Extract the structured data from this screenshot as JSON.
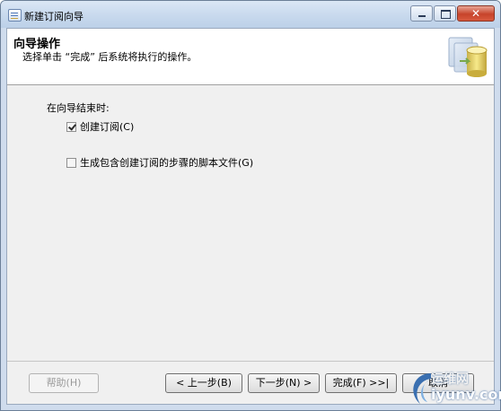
{
  "window": {
    "title": "新建订阅向导"
  },
  "header": {
    "title": "向导操作",
    "subtitle": "选择单击 “完成” 后系统将执行的操作。"
  },
  "content": {
    "label": "在向导结束时:",
    "options": [
      {
        "label": "创建订阅(C)",
        "checked": true
      },
      {
        "label": "生成包含创建订阅的步骤的脚本文件(G)",
        "checked": false
      }
    ]
  },
  "buttons": {
    "help": "帮助(H)",
    "back": "< 上一步(B)",
    "next": "下一步(N) >",
    "finish": "完成(F) >>|",
    "cancel": "取消"
  },
  "watermark": {
    "top": "运维网",
    "bottom": "iyunv.com"
  }
}
